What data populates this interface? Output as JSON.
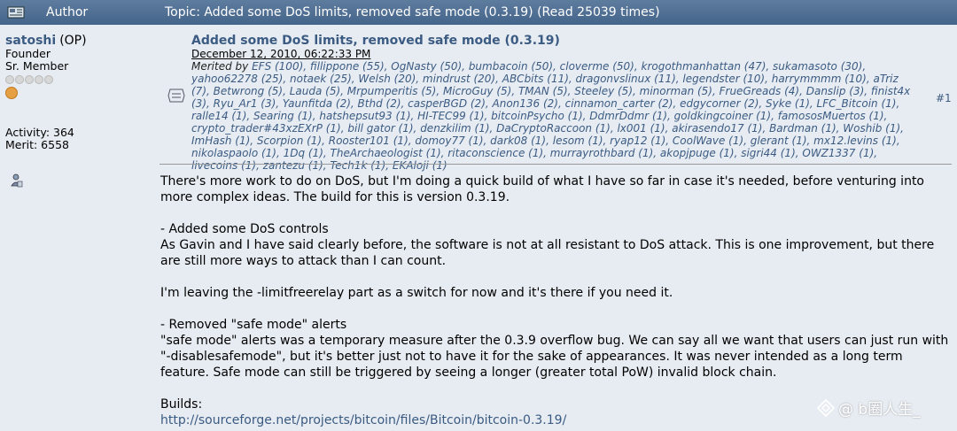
{
  "header": {
    "author_label": "Author",
    "topic_label": "Topic: Added some DoS limits, removed safe mode (0.3.19)  (Read 25039 times)"
  },
  "user": {
    "name": "satoshi",
    "op": "(OP)",
    "role": "Founder",
    "rank": "Sr. Member",
    "activity": "Activity: 364",
    "merit": "Merit: 6558"
  },
  "post": {
    "title": "Added some DoS limits, removed safe mode (0.3.19)",
    "date": "December 12, 2010, 06:22:33 PM",
    "merited_label": "Merited by",
    "merits": "EFS (100), fillippone (55), OgNasty (50), bumbacoin (50), cloverme (50), krogothmanhattan (47), sukamasoto (30), yahoo62278 (25), notaek (25), Welsh (20), mindrust (20), ABCbits (11), dragonvslinux (11), legendster (10), harrymmmm (10), aTriz (7), Betwrong (5), Lauda (5), Mrpumperitis (5), MicroGuy (5), TMAN (5), Steeley (5), minorman (5), FrueGreads (4), Danslip (3), finist4x (3), Ryu_Ar1 (3), Yaunfitda (2), Bthd (2), casperBGD (2), Anon136 (2), cinnamon_carter (2), edgycorner (2), Syke (1), LFC_Bitcoin (1), ralle14 (1), Searing (1), hatshepsut93 (1), HI-TEC99 (1), bitcoinPsycho (1), DdmrDdmr (1), goldkingcoiner (1), famososMuertos (1), crypto_trader#43xzEXrP (1), bill gator (1), denzkilim (1), DaCryptoRaccoon (1), lx001 (1), akirasendo17 (1), Bardman (1), Woshib (1), ImHash (1), Scorpion (1), Rooster101 (1), domoy77 (1), dark08 (1), lesom (1), ryap12 (1), CoolWave (1), glerant (1), mx12.levins (1), nikolaspaolo (1), 1Dq (1), TheArchaeologist (1), ritaconscience (1), murrayrothbard (1), akopjpuge (1), sigri44 (1), OWZ1337 (1), livecoins (1), zantezu (1), Tech1k (1), EKAloji (1)",
    "number": "#1",
    "p1": "There's more work to do on DoS, but I'm doing a quick build of what I have so far in case it's needed, before venturing into more complex ideas.  The build for this is version 0.3.19.",
    "p2a": "- Added some DoS controls",
    "p2b": "As Gavin and I have said clearly before, the software is not at all resistant to DoS attack.  This is one improvement, but there are still more ways to attack than I can count.",
    "p3": "I'm leaving the -limitfreerelay part as a switch for now and it's there if you need it.",
    "p4a": "- Removed \"safe mode\" alerts",
    "p4b": "\"safe mode\" alerts was a temporary measure after the 0.3.9 overflow bug.  We can say all we want that users can just run with \"-disablesafemode\", but it's better just not to have it for the sake of appearances.  It was never intended as a long term feature.  Safe mode can still be triggered by seeing a longer (greater total PoW) invalid block chain.",
    "builds_label": "Builds:",
    "builds_link": "http://sourceforge.net/projects/bitcoin/files/Bitcoin/bitcoin-0.3.19/"
  },
  "watermark": "@ b圈人生_",
  "colors": {
    "header_bg": "#4f6f94",
    "link": "#3b5b83",
    "page_bg": "#e7ecf2"
  }
}
